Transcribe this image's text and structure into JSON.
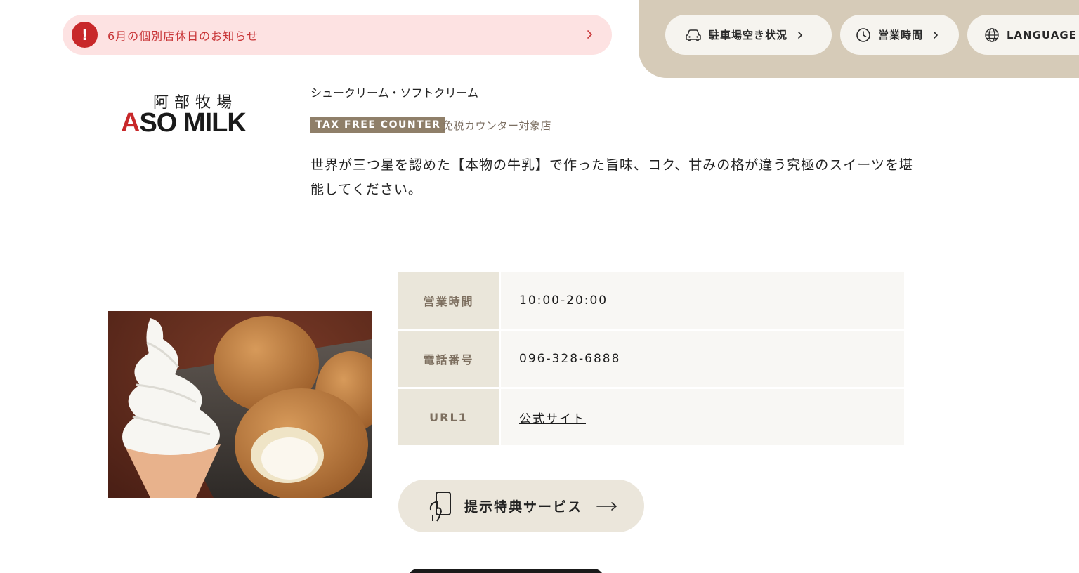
{
  "notice": {
    "alert_glyph": "!",
    "text": "6月の個別店休日のお知らせ",
    "color": "#c8282a",
    "icon": "alert-icon"
  },
  "utility_nav": {
    "background": "#d6cbb8",
    "parking": {
      "label": "駐車場空き状況",
      "icon": "car-icon"
    },
    "hours": {
      "label": "営業時間",
      "icon": "clock-icon"
    },
    "language": {
      "label": "LANGUAGE",
      "icon": "globe-icon"
    }
  },
  "logo": {
    "kanji": "阿部牧場",
    "text_a": "A",
    "text_rest": "SO MILK"
  },
  "shop": {
    "category": "シュークリーム・ソフトクリーム",
    "tax_free_badge": "TAX FREE COUNTER",
    "tax_free_note": "免税カウンター対象店",
    "description": "世界が三つ星を認めた【本物の牛乳】で作った旨味、コク、甘みの格が違う究極のスイーツを堪能してください。"
  },
  "info": {
    "hours_label": "営業時間",
    "hours_value": "10:00-20:00",
    "phone_label": "電話番号",
    "phone_value": "096-328-6888",
    "url_label": "URL1",
    "url_value": "公式サイト"
  },
  "benefit": {
    "label": "提示特典サービス",
    "icon": "hand-phone-icon",
    "arrow_icon": "arrow-right-icon"
  },
  "image": {
    "name": "soft-cream-and-cream-puffs-photo"
  }
}
